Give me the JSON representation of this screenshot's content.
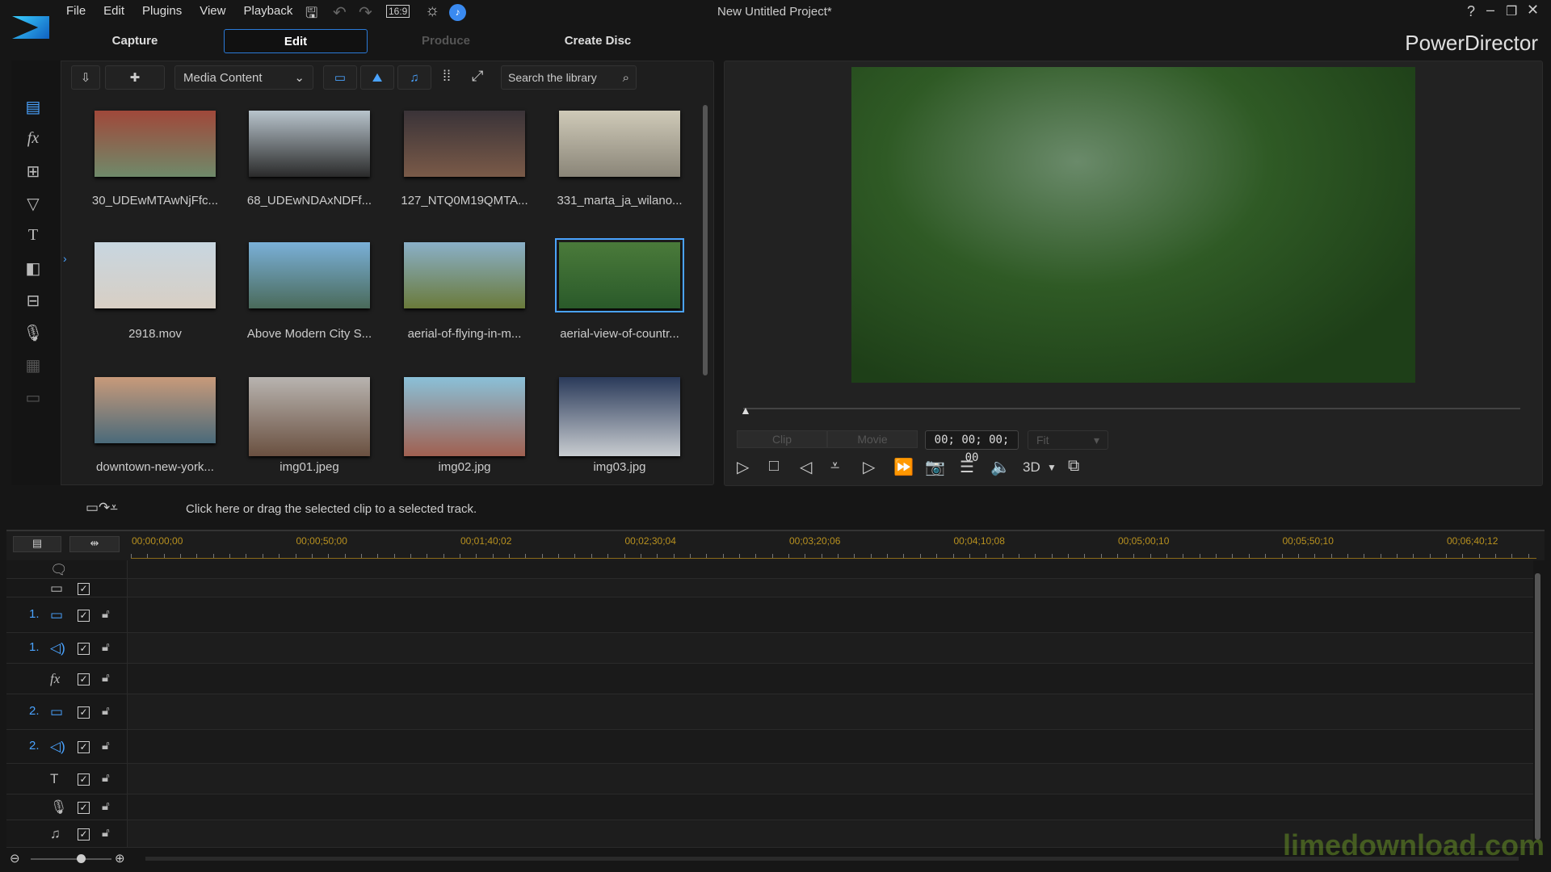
{
  "app": {
    "title": "New Untitled Project*",
    "brand": "PowerDirector",
    "watermark": "limedownload.com"
  },
  "menu": [
    "File",
    "Edit",
    "Plugins",
    "View",
    "Playback"
  ],
  "toolbar": {
    "aspect": "16:9"
  },
  "tabs": [
    {
      "label": "Capture"
    },
    {
      "label": "Edit",
      "active": true
    },
    {
      "label": "Produce",
      "disabled": true
    },
    {
      "label": "Create Disc"
    }
  ],
  "library": {
    "dropdown": "Media Content",
    "search_placeholder": "Search the library",
    "items": [
      {
        "label": "30_UDEwMTAwNjFfc...",
        "colors": [
          "#a0483a",
          "#6f8a6a"
        ]
      },
      {
        "label": "68_UDEwNDAxNDFf...",
        "colors": [
          "#b8c4cc",
          "#2a2a2a"
        ]
      },
      {
        "label": "127_NTQ0M19QMTA...",
        "colors": [
          "#3a3338",
          "#7a5a48"
        ]
      },
      {
        "label": "331_marta_ja_wilano...",
        "colors": [
          "#cfcab8",
          "#8a8578"
        ]
      },
      {
        "label": "2918.mov",
        "colors": [
          "#c8d6e0",
          "#d8cfc4"
        ]
      },
      {
        "label": "Above Modern City S...",
        "colors": [
          "#7ab0d8",
          "#4a6a5a"
        ]
      },
      {
        "label": "aerial-of-flying-in-m...",
        "colors": [
          "#8ab0c8",
          "#6a7a3a"
        ]
      },
      {
        "label": "aerial-view-of-countr...",
        "colors": [
          "#4a7a3a",
          "#2a5a2a"
        ],
        "selected": true
      },
      {
        "label": "downtown-new-york...",
        "colors": [
          "#c89a7a",
          "#4a6a7a"
        ]
      },
      {
        "label": "img01.jpeg",
        "colors": [
          "#b8b4b0",
          "#6a5040"
        ]
      },
      {
        "label": "img02.jpg",
        "colors": [
          "#8ac0d8",
          "#a06050"
        ]
      },
      {
        "label": "img03.jpg",
        "colors": [
          "#2a3a5a",
          "#c8ccd0"
        ]
      }
    ]
  },
  "preview": {
    "clip": "Clip",
    "movie": "Movie",
    "timecode": "00; 00; 00; 00",
    "fit": "Fit",
    "three_d": "3D"
  },
  "message": "Click here or drag the selected clip to a selected track.",
  "ruler": [
    "00;00;00;00",
    "00;00;50;00",
    "00;01;40;02",
    "00;02;30;04",
    "00;03;20;06",
    "00;04;10;08",
    "00;05;00;10",
    "00;05;50;10",
    "00;06;40;12"
  ],
  "tracks": [
    {
      "num": "",
      "icon": "chapter"
    },
    {
      "num": "",
      "icon": "subtitle"
    },
    {
      "num": "1.",
      "icon": "video"
    },
    {
      "num": "1.",
      "icon": "audio"
    },
    {
      "num": "",
      "icon": "fx"
    },
    {
      "num": "2.",
      "icon": "video"
    },
    {
      "num": "2.",
      "icon": "audio"
    },
    {
      "num": "",
      "icon": "title"
    },
    {
      "num": "",
      "icon": "voice"
    },
    {
      "num": "",
      "icon": "music"
    }
  ]
}
